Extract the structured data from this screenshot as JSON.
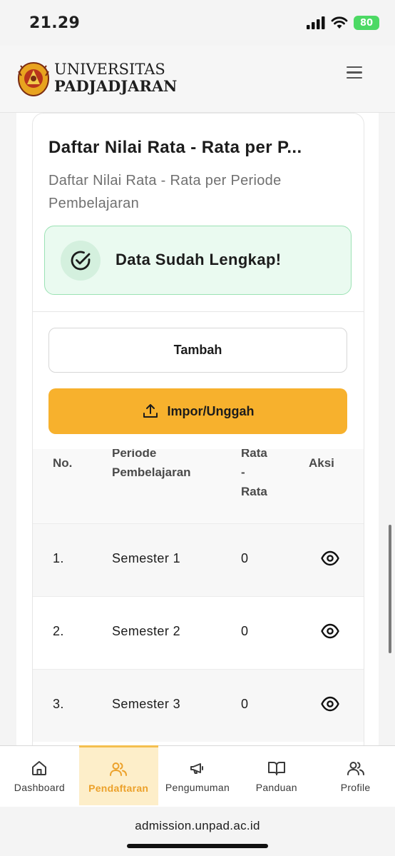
{
  "status": {
    "time": "21.29",
    "battery": "80"
  },
  "brand": {
    "line1": "UNIVERSITAS",
    "line2": "PADJADJARAN"
  },
  "card": {
    "title": "Daftar Nilai Rata - Rata per P...",
    "subtitle": "Daftar Nilai Rata - Rata per Periode Pembelajaran"
  },
  "alert": {
    "text": "Data Sudah Lengkap!",
    "color": "#eafaf0"
  },
  "buttons": {
    "tambah": "Tambah",
    "impor": "Impor/Unggah",
    "impor_color": "#f7b12d"
  },
  "table": {
    "headers": {
      "no": "No.",
      "periode_line1": "Periode",
      "periode_line2": "Pembelajaran",
      "rata_line1": "Rata",
      "rata_line2": "-",
      "rata_line3": "Rata",
      "aksi": "Aksi"
    },
    "rows": [
      {
        "no": "1.",
        "periode": "Semester 1",
        "rata": "0",
        "icon": "eye-icon"
      },
      {
        "no": "2.",
        "periode": "Semester 2",
        "rata": "0",
        "icon": "eye-icon"
      },
      {
        "no": "3.",
        "periode": "Semester 3",
        "rata": "0",
        "icon": "eye-icon"
      }
    ]
  },
  "nav": {
    "items": [
      {
        "label": "Dashboard",
        "icon": "home-icon"
      },
      {
        "label": "Pendaftaran",
        "icon": "users-icon",
        "active": true
      },
      {
        "label": "Pengumuman",
        "icon": "megaphone-icon"
      },
      {
        "label": "Panduan",
        "icon": "book-icon"
      },
      {
        "label": "Profile",
        "icon": "users-icon"
      }
    ],
    "active_color": "#eca12a"
  },
  "browser": {
    "url": "admission.unpad.ac.id"
  }
}
